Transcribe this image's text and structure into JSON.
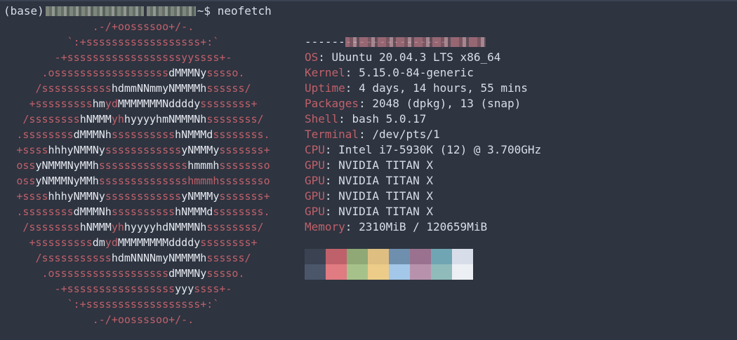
{
  "prompt": {
    "env": "(base)",
    "suffix": "~$",
    "command": "neofetch"
  },
  "logo_lines": [
    [
      {
        "t": ".-/+oossssoo+/-.",
        "c": "r"
      }
    ],
    [
      {
        "t": "`:+ssssssssssssssssss+:`",
        "c": "r"
      }
    ],
    [
      {
        "t": "-+ssssssssssssssssssyyssss+-",
        "c": "r"
      }
    ],
    [
      {
        "t": ".ossssssssssssssssss",
        "c": "r"
      },
      {
        "t": "dMMMNy",
        "c": "w"
      },
      {
        "t": "sssso.",
        "c": "r"
      }
    ],
    [
      {
        "t": "/sssssssssss",
        "c": "r"
      },
      {
        "t": "hdmmNNmmyNMMMMh",
        "c": "w"
      },
      {
        "t": "ssssss/",
        "c": "r"
      }
    ],
    [
      {
        "t": "+sssssssss",
        "c": "r"
      },
      {
        "t": "hm",
        "c": "w"
      },
      {
        "t": "yd",
        "c": "r"
      },
      {
        "t": "MMMMMMMNddddy",
        "c": "w"
      },
      {
        "t": "ssssssss+",
        "c": "r"
      }
    ],
    [
      {
        "t": "/ssssssss",
        "c": "r"
      },
      {
        "t": "hNMMM",
        "c": "w"
      },
      {
        "t": "yh",
        "c": "r"
      },
      {
        "t": "hyyyyhmNMMMNh",
        "c": "w"
      },
      {
        "t": "ssssssss/",
        "c": "r"
      }
    ],
    [
      {
        "t": ".ssssssss",
        "c": "r"
      },
      {
        "t": "dMMMNh",
        "c": "w"
      },
      {
        "t": "ssssssssss",
        "c": "r"
      },
      {
        "t": "hNMMMd",
        "c": "w"
      },
      {
        "t": "ssssssss.",
        "c": "r"
      }
    ],
    [
      {
        "t": "+ssss",
        "c": "r"
      },
      {
        "t": "hhhyNMMNy",
        "c": "w"
      },
      {
        "t": "ssssssssssss",
        "c": "r"
      },
      {
        "t": "yNMMMy",
        "c": "w"
      },
      {
        "t": "sssssss+",
        "c": "r"
      }
    ],
    [
      {
        "t": "oss",
        "c": "r"
      },
      {
        "t": "yNMMMNyMMh",
        "c": "w"
      },
      {
        "t": "ssssssssssssss",
        "c": "r"
      },
      {
        "t": "hmmmh",
        "c": "w"
      },
      {
        "t": "ssssssso",
        "c": "r"
      }
    ],
    [
      {
        "t": "oss",
        "c": "r"
      },
      {
        "t": "yNMMMNyMMh",
        "c": "w"
      },
      {
        "t": "sssssssssssssshmmmhssssssso",
        "c": "r"
      }
    ],
    [
      {
        "t": "+ssss",
        "c": "r"
      },
      {
        "t": "hhhyNMMNy",
        "c": "w"
      },
      {
        "t": "ssssssssssss",
        "c": "r"
      },
      {
        "t": "yNMMMy",
        "c": "w"
      },
      {
        "t": "sssssss+",
        "c": "r"
      }
    ],
    [
      {
        "t": ".ssssssss",
        "c": "r"
      },
      {
        "t": "dMMMNh",
        "c": "w"
      },
      {
        "t": "ssssssssss",
        "c": "r"
      },
      {
        "t": "hNMMMd",
        "c": "w"
      },
      {
        "t": "ssssssss.",
        "c": "r"
      }
    ],
    [
      {
        "t": "/ssssssss",
        "c": "r"
      },
      {
        "t": "hNMMM",
        "c": "w"
      },
      {
        "t": "yh",
        "c": "r"
      },
      {
        "t": "hyyyyhdNMMMNh",
        "c": "w"
      },
      {
        "t": "ssssssss/",
        "c": "r"
      }
    ],
    [
      {
        "t": "+sssssssss",
        "c": "r"
      },
      {
        "t": "dm",
        "c": "w"
      },
      {
        "t": "yd",
        "c": "r"
      },
      {
        "t": "MMMMMMMMddddy",
        "c": "w"
      },
      {
        "t": "ssssssss+",
        "c": "r"
      }
    ],
    [
      {
        "t": "/sssssssssss",
        "c": "r"
      },
      {
        "t": "hdmNNNNmyNMMMMh",
        "c": "w"
      },
      {
        "t": "ssssss/",
        "c": "r"
      }
    ],
    [
      {
        "t": ".ossssssssssssssssss",
        "c": "r"
      },
      {
        "t": "dMMMNy",
        "c": "w"
      },
      {
        "t": "sssso.",
        "c": "r"
      }
    ],
    [
      {
        "t": "-+sssssssssssssssss",
        "c": "r"
      },
      {
        "t": "yyy",
        "c": "w"
      },
      {
        "t": "ssss+-",
        "c": "r"
      }
    ],
    [
      {
        "t": "`:+ssssssssssssssssss+:`",
        "c": "r"
      }
    ],
    [
      {
        "t": ".-/+oossssoo+/-.",
        "c": "r"
      }
    ]
  ],
  "info": {
    "separator": "---------------------",
    "rows": [
      {
        "key": "OS",
        "value": "Ubuntu 20.04.3 LTS x86_64"
      },
      {
        "key": "Kernel",
        "value": "5.15.0-84-generic"
      },
      {
        "key": "Uptime",
        "value": "4 days, 14 hours, 55 mins"
      },
      {
        "key": "Packages",
        "value": "2048 (dpkg), 13 (snap)"
      },
      {
        "key": "Shell",
        "value": "bash 5.0.17"
      },
      {
        "key": "Terminal",
        "value": "/dev/pts/1"
      },
      {
        "key": "CPU",
        "value": "Intel i7-5930K (12) @ 3.700GHz"
      },
      {
        "key": "GPU",
        "value": "NVIDIA TITAN X"
      },
      {
        "key": "GPU",
        "value": "NVIDIA TITAN X"
      },
      {
        "key": "GPU",
        "value": "NVIDIA TITAN X"
      },
      {
        "key": "GPU",
        "value": "NVIDIA TITAN X"
      },
      {
        "key": "Memory",
        "value": "2310MiB / 120659MiB"
      }
    ]
  },
  "palette": {
    "normal": [
      "#3b4252",
      "#bf616a",
      "#8fa876",
      "#dfbe82",
      "#6f8fae",
      "#9a7290",
      "#70a6b3",
      "#d8dee9"
    ],
    "bright": [
      "#4c566a",
      "#e07b82",
      "#a6c28a",
      "#eccc88",
      "#a3c7e8",
      "#b892ad",
      "#8fbcbb",
      "#eceff4"
    ]
  },
  "colors": {
    "background": "#2e3440",
    "foreground": "#d8dee9",
    "accent_red": "#bf616a"
  }
}
